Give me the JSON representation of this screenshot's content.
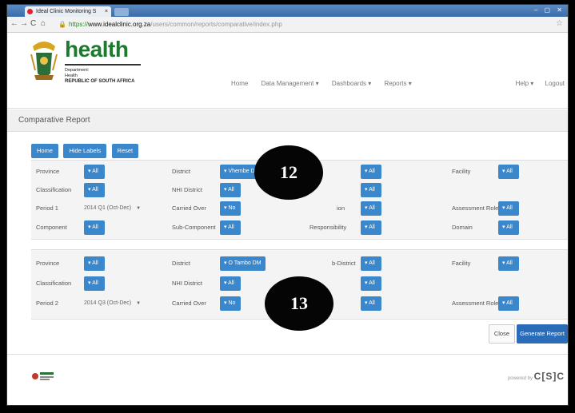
{
  "browser": {
    "tab_title": "Ideal Clinic Monitoring S",
    "url_https": "https://",
    "url_host": "www.idealclinic.org.za",
    "url_path": "/users/common/reports/comparative/index.php"
  },
  "header": {
    "logo_word": "health",
    "logo_line1": "Department:",
    "logo_line2": "Health",
    "logo_line3": "REPUBLIC OF SOUTH AFRICA",
    "nav": [
      "Home",
      "Data Management ▾",
      "Dashboards ▾",
      "Reports ▾"
    ],
    "right_nav": [
      "Help ▾",
      "Logout"
    ]
  },
  "page_title": "Comparative Report",
  "toolbar": [
    "Home",
    "Hide Labels",
    "Reset"
  ],
  "panel1": {
    "province_label": "Province",
    "province_value": "▾ All",
    "district_label": "District",
    "district_value": "▾ Vhembe D",
    "subdistrict_value": "▾ All",
    "facility_label": "Facility",
    "facility_value": "▾ All",
    "classification_label": "Classification",
    "classification_value": "▾ All",
    "nhi_label": "NHI District",
    "nhi_value": "▾ All",
    "cl_value": "▾ All",
    "period_label": "Period 1",
    "period_value": "2014 Q1 (Oct-Dec)",
    "carried_label": "Carried Over",
    "carried_value": "▾ No",
    "mid_row3_label": "ion",
    "mid_row3_value": "▾ All",
    "role_label": "Assessment Role",
    "role_value": "▾ All",
    "component_label": "Component",
    "component_value": "▾ All",
    "subcomp_label": "Sub-Component",
    "subcomp_value": "▾ All",
    "resp_label": "Responsibility",
    "resp_value": "▾ All",
    "domain_label": "Domain",
    "domain_value": "▾ All"
  },
  "panel2": {
    "province_label": "Province",
    "province_value": "▾ All",
    "district_label": "District",
    "district_value": "▾ O Tambo DM",
    "subdistrict_label": "b-District",
    "subdistrict_value": "▾ All",
    "facility_label": "Facility",
    "facility_value": "▾ All",
    "classification_label": "Classification",
    "classification_value": "▾ All",
    "nhi_label": "NHI District",
    "nhi_value": "▾ All",
    "cl_value": "▾ All",
    "period_label": "Period 2",
    "period_value": "2014 Q3 (Oct-Dec)",
    "carried_label": "Carried Over",
    "carried_value": "▾ No",
    "mid_row3_value": "▾ All",
    "role_label": "Assessment Role",
    "role_value": "▾ All"
  },
  "actions": {
    "close": "Close",
    "generate": "Generate Report"
  },
  "footer": {
    "powered_prefix": "powered by",
    "powered_brand": "C[S]C"
  },
  "callouts": [
    "12",
    "13"
  ]
}
